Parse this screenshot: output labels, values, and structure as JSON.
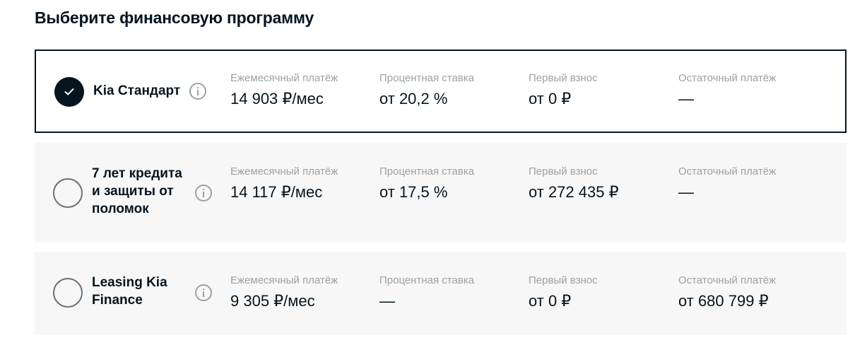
{
  "heading": "Выберите финансовую программу",
  "columns": {
    "monthly": "Ежемесячный платёж",
    "rate": "Процентная ставка",
    "down": "Первый взнос",
    "residual": "Остаточный платёж"
  },
  "programs": [
    {
      "selected": true,
      "name_lines": [
        "Kia Стандарт"
      ],
      "monthly": "14 903 ₽/мес",
      "rate": "от 20,2 %",
      "down": "от 0 ₽",
      "residual": "—"
    },
    {
      "selected": false,
      "name_lines": [
        "7 лет кредита",
        "и защиты от",
        "поломок"
      ],
      "monthly": "14 117 ₽/мес",
      "rate": "от 17,5 %",
      "down": "от 272 435 ₽",
      "residual": "—"
    },
    {
      "selected": false,
      "name_lines": [
        "Leasing Kia",
        "Finance"
      ],
      "monthly": "9 305 ₽/мес",
      "rate": "—",
      "down": "от 0 ₽",
      "residual": "от 680 799 ₽"
    }
  ],
  "icons": {
    "check": "check-icon",
    "info": "info-icon"
  },
  "colors": {
    "primary": "#05141f",
    "muted": "#9ba1a5",
    "card_bg": "#f7f7f7"
  }
}
